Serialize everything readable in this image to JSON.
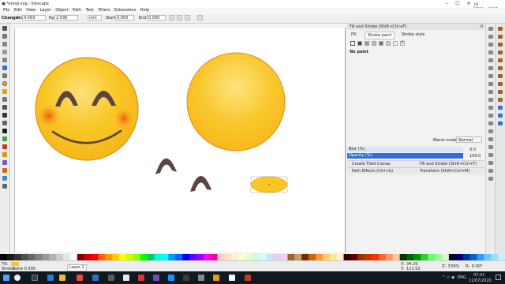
{
  "window": {
    "title": "*emoji.svg - Inkscape",
    "controls": [
      "–",
      "☐",
      "✕"
    ]
  },
  "top_right": {
    "fill_label": "Fill",
    "stroke_label": "Stroke",
    "stroke_value": "Unset"
  },
  "menu": [
    "File",
    "Edit",
    "View",
    "Layer",
    "Object",
    "Path",
    "Text",
    "Filters",
    "Extensions",
    "Help"
  ],
  "tool_controls": {
    "change_label": "Change:",
    "rx_label": "Rx:",
    "rx_value": "4.563",
    "ry_label": "Ry:",
    "ry_value": "2.036",
    "unit": "mm",
    "start_label": "Start:",
    "start_value": "0.000",
    "end_label": "End:",
    "end_value": "0.000"
  },
  "panel": {
    "tabs": [
      "Fill",
      "Stroke paint",
      "Stroke style"
    ],
    "header": "Fill and Stroke (Shift+Ctrl+F)",
    "no_paint": "No paint",
    "blend_label": "Blend mode:",
    "blend_value": "Normal",
    "blur_label": "Blur (%)",
    "blur_value": "0.0",
    "opacity_label": "Opacity (%)",
    "opacity_value": "100.0",
    "docked": [
      [
        "Create Tiled Clones",
        "Fill and Stroke (Shift+Ctrl+F)"
      ],
      [
        "Path Effects (Ctrl+&)",
        "Transform (Shift+Ctrl+M)"
      ]
    ]
  },
  "status": {
    "fill_label": "Fill:",
    "stroke_label": "Stroke:",
    "stroke_value": "None 0.300",
    "layer": "Layer 1",
    "x_label": "X:",
    "x_value": "34.29",
    "y_label": "Y:",
    "y_value": "121.52",
    "zoom_label": "Z:",
    "zoom_value": "539%",
    "rotation_label": "R:",
    "rotation_value": "0.00°"
  },
  "taskbar": {
    "lang": "ENG",
    "time": "07:41",
    "date": "11/07/2020"
  },
  "colors": {
    "emoji_yellow": "#f9c623",
    "emoji_edge": "#e68a1e",
    "brow_brown": "#5a4541",
    "cheek_orange": "#f06a18",
    "selection_blue": "#2f6fd6",
    "opacity_bar": "#2f6fd6"
  }
}
